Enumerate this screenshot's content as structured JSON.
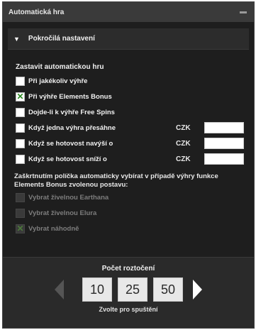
{
  "window": {
    "title": "Automatická hra"
  },
  "section": {
    "title": "Pokročilá nastavení"
  },
  "stop": {
    "label": "Zastavit automatickou hru",
    "options": [
      {
        "label": "Při jakékoliv výhře",
        "checked": false
      },
      {
        "label": "Při výhře Elements Bonus",
        "checked": true
      },
      {
        "label": "Dojde-li k výhře Free Spins",
        "checked": false
      },
      {
        "label": "Když jedna výhra přesáhne",
        "checked": false,
        "currency": "CZK",
        "value": ""
      },
      {
        "label": "Když se hotovost navýší o",
        "checked": false,
        "currency": "CZK",
        "value": ""
      },
      {
        "label": "Když se hotovost sníží o",
        "checked": false,
        "currency": "CZK",
        "value": ""
      }
    ]
  },
  "note": "Zaškrtnutím políčka automaticky vybírat v případě výhry funkce Elements Bonus zvolenou postavu:",
  "characters": [
    {
      "label": "Vybrat živelnou Earthana",
      "checked": false
    },
    {
      "label": "Vybrat živelnou Elura",
      "checked": false
    },
    {
      "label": "Vybrat náhodně",
      "checked": true
    }
  ],
  "spins": {
    "label": "Počet roztočení",
    "options": [
      "10",
      "25",
      "50"
    ],
    "footer": "Zvolte pro spuštění"
  },
  "colors": {
    "panel": "#1e1e1e",
    "check": "#2a8a20"
  }
}
